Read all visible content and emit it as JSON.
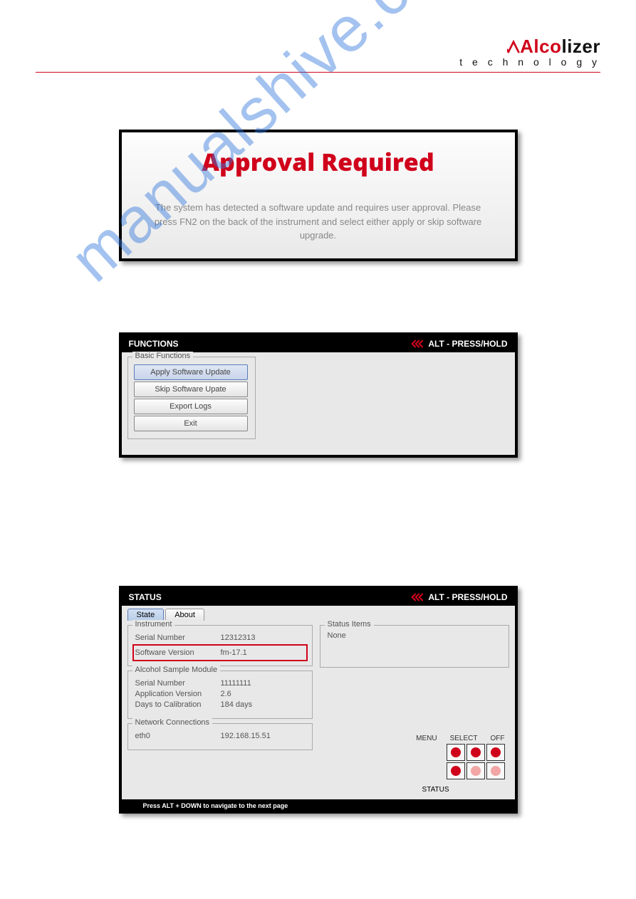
{
  "logo": {
    "brand_part1": "Alco",
    "brand_part2": "lizer",
    "subtitle": "t e c h n o l o g y"
  },
  "approval": {
    "title": "Approval Required",
    "message": "The system has detected a software update and requires user approval. Please press FN2 on the back of the instrument and select either apply or skip software upgrade."
  },
  "functions": {
    "header": "FUNCTIONS",
    "alt": "ALT - PRESS/HOLD",
    "fieldset_label": "Basic Functions",
    "buttons": {
      "apply": "Apply Software Update",
      "skip": "Skip Software Upate",
      "export": "Export Logs",
      "exit": "Exit"
    }
  },
  "status": {
    "header": "STATUS",
    "alt": "ALT - PRESS/HOLD",
    "tabs": {
      "state": "State",
      "about": "About"
    },
    "instrument": {
      "label": "Instrument",
      "serial_key": "Serial Number",
      "serial_val": "12312313",
      "sw_key": "Software Version",
      "sw_val": "fm-17.1"
    },
    "asm": {
      "label": "Alcohol Sample Module",
      "serial_key": "Serial Number",
      "serial_val": "11111111",
      "app_key": "Application Version",
      "app_val": "2.6",
      "cal_key": "Days to Calibration",
      "cal_val": "184 days"
    },
    "network": {
      "label": "Network Connections",
      "iface": "eth0",
      "ip": "192.168.15.51"
    },
    "status_items": {
      "label": "Status Items",
      "value": "None"
    },
    "hw_labels": {
      "menu": "MENU",
      "select": "SELECT",
      "off": "OFF",
      "status": "STATUS"
    },
    "footer": "Press ALT + DOWN to navigate to the next page"
  },
  "watermark": "manualshive.com"
}
